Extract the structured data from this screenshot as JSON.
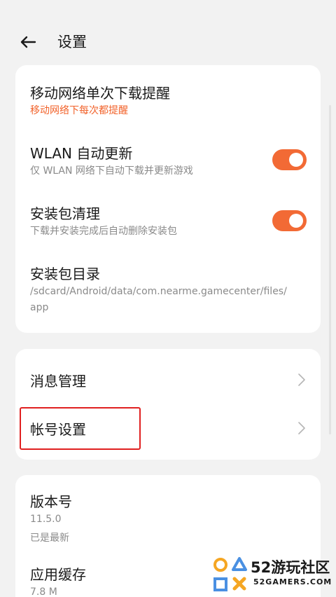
{
  "header": {
    "back_icon": "back-arrow-icon",
    "title": "设置"
  },
  "download_settings": {
    "mobile_alert": {
      "title": "移动网络单次下载提醒",
      "subtitle": "移动网络下每次都提醒",
      "subtitle_color": "#f2622a"
    },
    "wlan_update": {
      "title": "WLAN 自动更新",
      "subtitle": "仅 WLAN 网络下自动下载并更新游戏",
      "enabled": true
    },
    "package_cleanup": {
      "title": "安装包清理",
      "subtitle": "下载并安装完成后自动删除安装包",
      "enabled": true
    },
    "package_dir": {
      "title": "安装包目录",
      "path_line1": "/sdcard/Android/data/com.nearme.gamecenter/files/",
      "path_line2": "app"
    }
  },
  "management": {
    "message": {
      "title": "消息管理",
      "icon": "chevron-right-icon"
    },
    "account": {
      "title": "帐号设置",
      "icon": "chevron-right-icon"
    }
  },
  "info": {
    "version": {
      "title": "版本号",
      "value": "11.5.0",
      "status": "已是最新"
    },
    "cache": {
      "title": "应用缓存",
      "value": "7.8 M"
    }
  },
  "watermark": {
    "title": "52游玩社区",
    "subtitle": "52GAMERS.COM"
  },
  "colors": {
    "accent": "#f26a35",
    "highlight_box": "#e02020",
    "background": "#f2f2f2",
    "card": "#ffffff"
  }
}
